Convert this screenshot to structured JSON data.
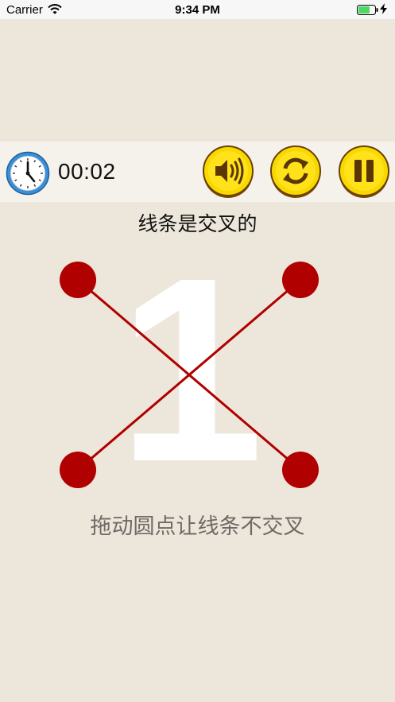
{
  "status_bar": {
    "carrier": "Carrier",
    "time": "9:34 PM",
    "icons": [
      "wifi-icon",
      "battery-icon",
      "charging-bolt-icon"
    ]
  },
  "toolbar": {
    "timer": "00:02",
    "icons": [
      "clock-icon",
      "sound-icon",
      "restart-icon",
      "pause-icon"
    ],
    "button_color": "#f7d800"
  },
  "game": {
    "hint": "线条是交叉的",
    "level": "1",
    "instruction": "拖动圆点让线条不交叉",
    "dot_color": "#b00000",
    "line_color": "#b00000"
  }
}
